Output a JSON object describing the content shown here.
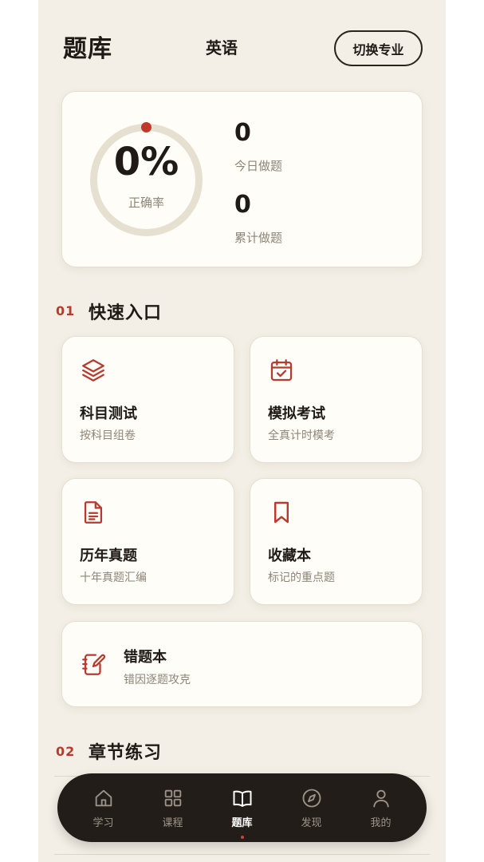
{
  "header": {
    "title": "题库",
    "subject": "英语",
    "switch_label": "切换专业"
  },
  "stats": {
    "accuracy_text": "0%",
    "accuracy_value": 0,
    "accuracy_label": "正确率",
    "today_count": "0",
    "today_label": "今日做题",
    "total_count": "0",
    "total_label": "累计做题",
    "ring_color": "#e6e0d1",
    "accent_color": "#b83a2e"
  },
  "quick": {
    "num": "01",
    "title": "快速入口",
    "tiles": [
      {
        "icon": "layers-icon",
        "title": "科目测试",
        "sub": "按科目组卷"
      },
      {
        "icon": "calendar-check-icon",
        "title": "模拟考试",
        "sub": "全真计时模考"
      },
      {
        "icon": "document-icon",
        "title": "历年真题",
        "sub": "十年真题汇编"
      },
      {
        "icon": "bookmark-icon",
        "title": "收藏本",
        "sub": "标记的重点题"
      }
    ],
    "wide": {
      "icon": "notebook-edit-icon",
      "title": "错题本",
      "sub": "错因逐题攻克"
    }
  },
  "chapter": {
    "num": "02",
    "title": "章节练习"
  },
  "nav": {
    "items": [
      {
        "icon": "home-icon",
        "label": "学习"
      },
      {
        "icon": "grid-icon",
        "label": "课程"
      },
      {
        "icon": "book-icon",
        "label": "题库",
        "active": true
      },
      {
        "icon": "compass-icon",
        "label": "发现"
      },
      {
        "icon": "user-icon",
        "label": "我的"
      }
    ]
  }
}
